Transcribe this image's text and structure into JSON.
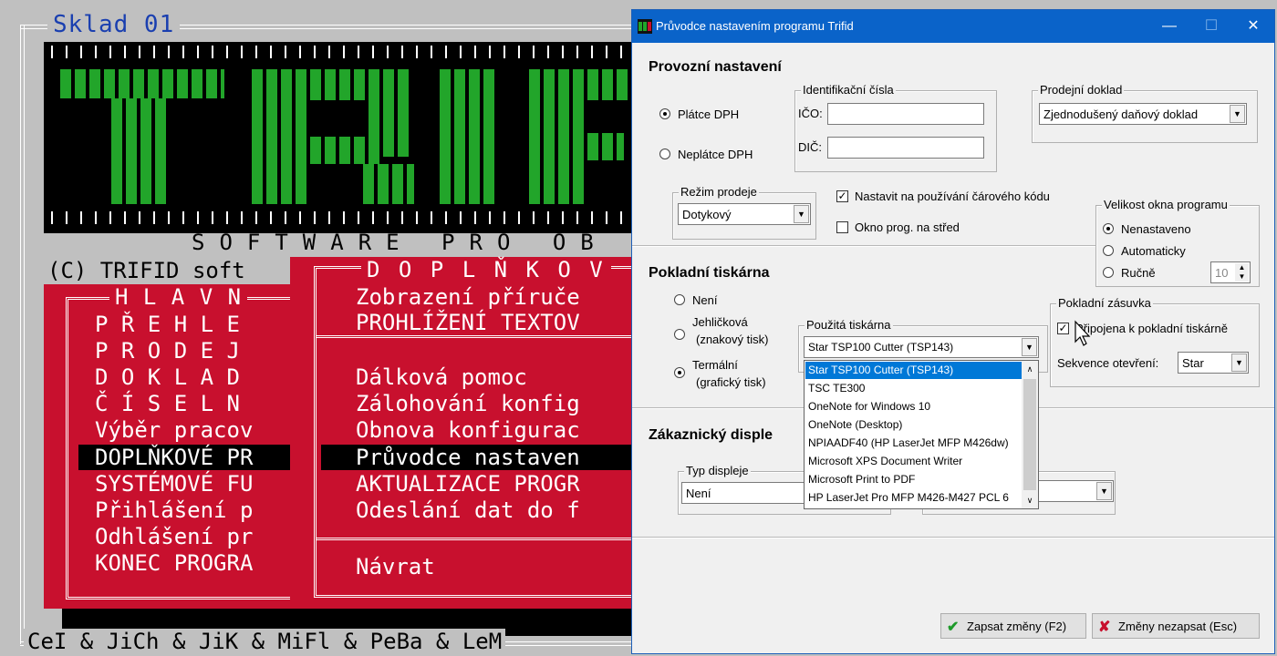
{
  "console": {
    "sklad": "Sklad 01",
    "software_line": "SOFTWARE PRO OB",
    "copyright": "(C) TRIFID soft",
    "doplnkove_header": "D O P L Ň K O V",
    "hlavni_header": "H L A V N",
    "credits": "CeI & JiCh & JiK & MiFl & PeBa & LeM",
    "main_menu": [
      "P Ř E H L E",
      "P R O D E J",
      "D O K L A D",
      "Č Í S E L N",
      "Výběr pracov",
      "DOPLŇKOVÉ PR",
      "SYSTÉMOVÉ FU",
      "Přihlášení p",
      "Odhlášení pr",
      "KONEC PROGRA"
    ],
    "sub_menu_a": [
      "Zobrazení příruče",
      "PROHLÍŽENÍ TEXTOV"
    ],
    "sub_menu_b": [
      "Dálková pomoc",
      "Zálohování konfig",
      "Obnova konfigurac",
      "Průvodce nastaven",
      "AKTUALIZACE PROGR",
      "Odeslání dat do f"
    ],
    "sub_menu_return": "Návrat"
  },
  "dialog": {
    "title": "Průvodce nastavením programu Trifid",
    "sections": {
      "provozni": "Provozní nastavení",
      "pokladni": "Pokladní tiskárna",
      "zakaznicky": "Zákaznický disple"
    },
    "dph": {
      "platce": "Plátce DPH",
      "neplatce": "Neplátce DPH"
    },
    "ident": {
      "legend": "Identifikační čísla",
      "ico_label": "IČO:",
      "dic_label": "DIČ:",
      "ico_value": "",
      "dic_value": ""
    },
    "prodejni": {
      "legend": "Prodejní doklad",
      "value": "Zjednodušený daňový doklad"
    },
    "rezim": {
      "legend": "Režim prodeje",
      "value": "Dotykový"
    },
    "barcode_label": "Nastavit na používání čárového kódu",
    "center_label": "Okno prog. na střed",
    "velikost": {
      "legend": "Velikost okna programu",
      "nenastaveno": "Nenastaveno",
      "automaticky": "Automaticky",
      "rucne": "Ručně",
      "spin_value": "10"
    },
    "printer_type": {
      "neni": "Není",
      "jehlickova": "Jehličková",
      "jehlickova_sub": "(znakový tisk)",
      "termalni": "Termální",
      "termalni_sub": "(grafický tisk)"
    },
    "pouzita": {
      "legend": "Použitá tiskárna",
      "value": "Star TSP100 Cutter (TSP143)"
    },
    "dropdown_items": [
      "Star TSP100 Cutter (TSP143)",
      "TSC TE300",
      "OneNote for Windows 10",
      "OneNote (Desktop)",
      "NPIAADF40 (HP LaserJet MFP M426dw)",
      "Microsoft XPS Document Writer",
      "Microsoft Print to PDF",
      "HP LaserJet Pro MFP M426-M427 PCL 6"
    ],
    "zasuvka": {
      "legend": "Pokladní zásuvka",
      "connect_label": "Připojena k pokladní tiskárně",
      "seq_label": "Sekvence otevření:",
      "seq_value": "Star"
    },
    "typ_displeje": {
      "legend": "Typ displeje",
      "value": "Není"
    },
    "buttons": {
      "save": "Zapsat změny (F2)",
      "cancel": "Změny nezapsat (Esc)"
    }
  },
  "colors": {
    "titlebar": "#0a63c9",
    "console_red": "#c8102e",
    "logo_green": "#22a52a",
    "selection": "#0078d7"
  }
}
